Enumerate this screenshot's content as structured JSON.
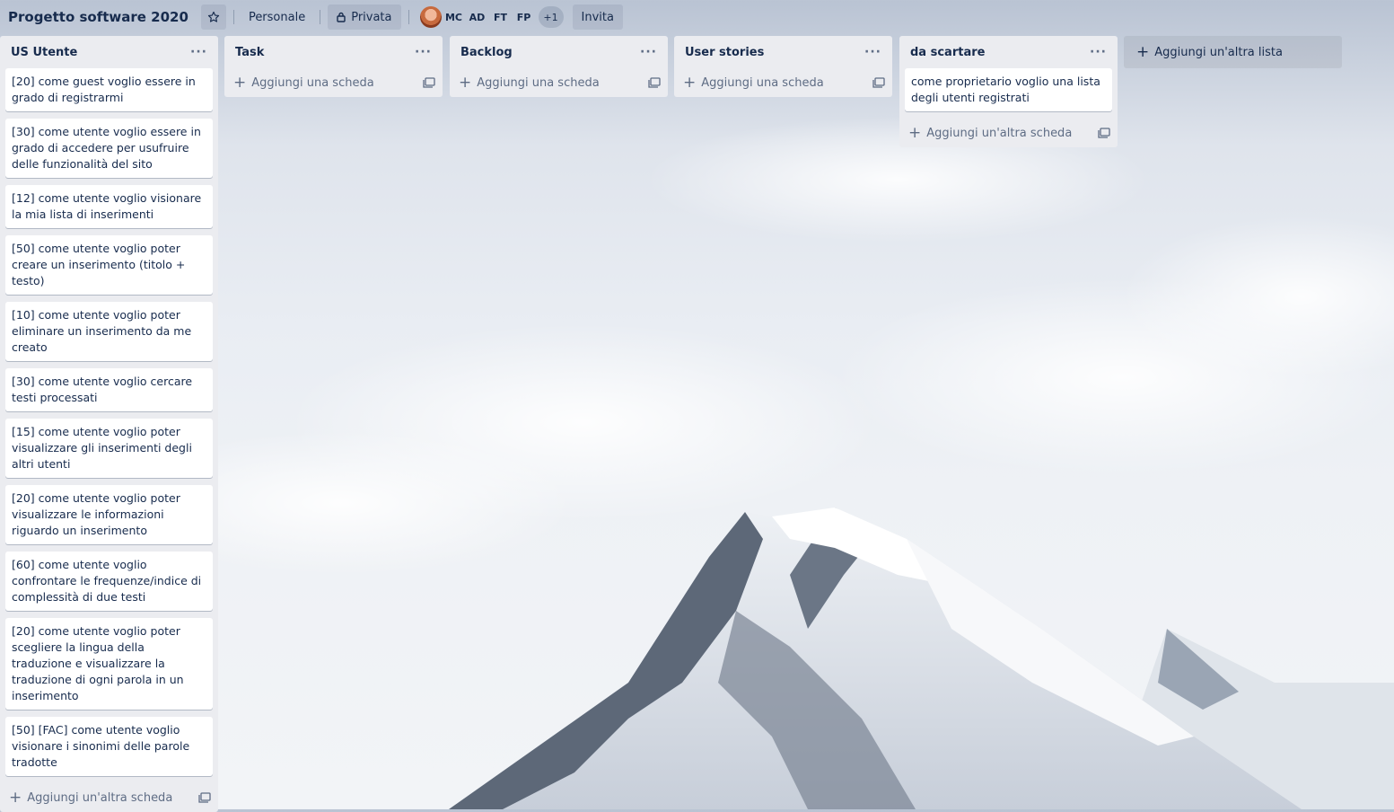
{
  "board": {
    "title": "Progetto software 2020",
    "star_icon": "star-icon",
    "workspace": "Personale",
    "visibility": "Privata",
    "members": [
      "MC",
      "AD",
      "FT",
      "FP"
    ],
    "more_members": "+1",
    "invite": "Invita"
  },
  "lists": [
    {
      "title": "US Utente",
      "cards": [
        "[20] come guest voglio essere in grado di registrarmi",
        "[30] come utente voglio essere in grado di accedere per usufruire delle funzionalità del sito",
        "[12] come utente voglio visionare la mia lista di inserimenti",
        "[50] come utente voglio poter creare un inserimento (titolo + testo)",
        "[10] come utente voglio poter eliminare un inserimento da me creato",
        "[30] come utente voglio cercare testi processati",
        "[15] come utente voglio poter visualizzare gli inserimenti degli altri utenti",
        "[20] come utente voglio poter visualizzare le informazioni riguardo un inserimento",
        "[60] come utente voglio confrontare le frequenze/indice di complessità di due testi",
        "[20] come utente voglio poter scegliere la lingua della traduzione e visualizzare la traduzione di ogni parola in un inserimento",
        "[50] [FAC] come utente voglio visionare i sinonimi delle parole tradotte"
      ],
      "add_label": "Aggiungi un'altra scheda"
    },
    {
      "title": "Task",
      "cards": [],
      "add_label": "Aggiungi una scheda"
    },
    {
      "title": "Backlog",
      "cards": [],
      "add_label": "Aggiungi una scheda"
    },
    {
      "title": "User stories",
      "cards": [],
      "add_label": "Aggiungi una scheda"
    },
    {
      "title": "da scartare",
      "cards": [
        "come proprietario voglio una lista degli utenti registrati"
      ],
      "add_label": "Aggiungi un'altra scheda"
    }
  ],
  "add_list_label": "Aggiungi un'altra lista",
  "menu_glyph": "···",
  "plus_glyph": "+"
}
